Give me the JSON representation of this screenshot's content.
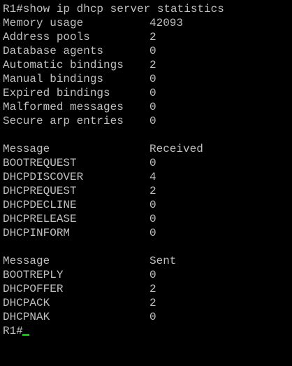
{
  "terminal": {
    "command": "R1#show ip dhcp server statistics",
    "stats": [
      {
        "label": "Memory usage",
        "value": "42093"
      },
      {
        "label": "Address pools",
        "value": "2"
      },
      {
        "label": "Database agents",
        "value": "0"
      },
      {
        "label": "Automatic bindings",
        "value": "2"
      },
      {
        "label": "Manual bindings",
        "value": "0"
      },
      {
        "label": "Expired bindings",
        "value": "0"
      },
      {
        "label": "Malformed messages",
        "value": "0"
      },
      {
        "label": "Secure arp entries",
        "value": "0"
      }
    ],
    "received_header": {
      "message": "Message",
      "count": "Received"
    },
    "received": [
      {
        "label": "BOOTREQUEST",
        "value": "0"
      },
      {
        "label": "DHCPDISCOVER",
        "value": "4"
      },
      {
        "label": "DHCPREQUEST",
        "value": "2"
      },
      {
        "label": "DHCPDECLINE",
        "value": "0"
      },
      {
        "label": "DHCPRELEASE",
        "value": "0"
      },
      {
        "label": "DHCPINFORM",
        "value": "0"
      }
    ],
    "sent_header": {
      "message": "Message",
      "count": "Sent"
    },
    "sent": [
      {
        "label": "BOOTREPLY",
        "value": "0"
      },
      {
        "label": "DHCPOFFER",
        "value": "2"
      },
      {
        "label": "DHCPACK",
        "value": "2"
      },
      {
        "label": "DHCPNAK",
        "value": "0"
      }
    ],
    "prompt": "R1#"
  },
  "colors": {
    "background": "#000000",
    "text": "#c0c0c0",
    "cursor": "#00cc00"
  }
}
